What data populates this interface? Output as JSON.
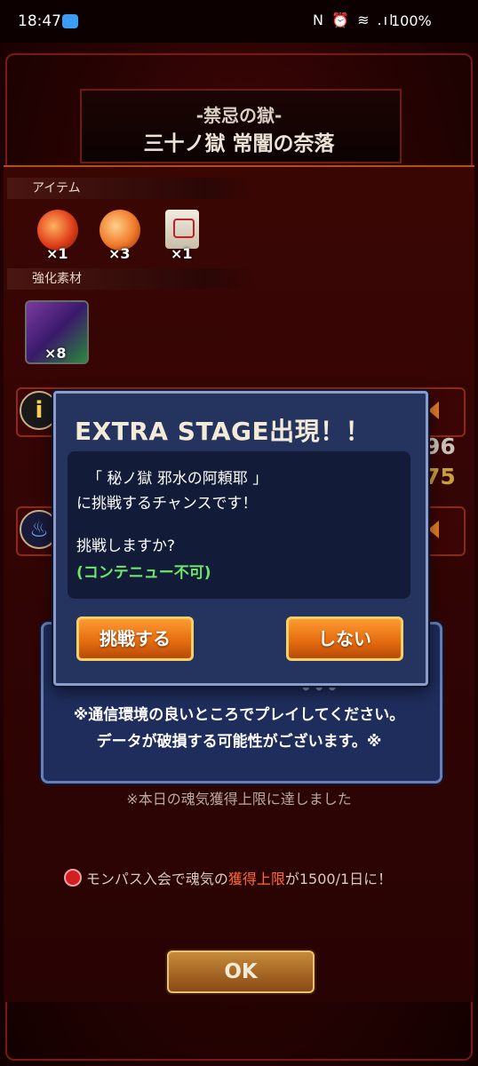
{
  "status_bar": {
    "time": "18:47",
    "right_icons": "N ⏰ ≋ .ıl",
    "battery": "100%"
  },
  "header": {
    "subtitle": "-禁忌の獄-",
    "title": "三十ノ獄 常闇の奈落"
  },
  "rewards": {
    "items_label": "アイテム",
    "items": [
      {
        "icon": "red-orb-icon",
        "count": "×1"
      },
      {
        "icon": "orange-orb-icon",
        "count": "×3"
      },
      {
        "icon": "scroll-icon",
        "count": "×1"
      }
    ],
    "materials_label": "強化素材",
    "materials": [
      {
        "icon": "monster-icon",
        "count": "×8"
      }
    ]
  },
  "background_stats": {
    "value1": "96",
    "value2": "75"
  },
  "notice": {
    "line1": "※通信環境の良いところでプレイしてください。",
    "line2": "データが破損する可能性がございます。※"
  },
  "limit_text": "※本日の魂気獲得上限に達しました",
  "monpass": {
    "prefix": "モンパス入会で魂気の",
    "highlight": "獲得上限",
    "suffix": "が1500/1日に！"
  },
  "ok_label": "OK",
  "modal": {
    "title": "EXTRA STAGE出現！！",
    "line1": "「 秘ノ獄 邪水の阿頼耶 」",
    "line2": "に挑戦するチャンスです！",
    "line3": "挑戦しますか?",
    "line4": "(コンテニュー不可)",
    "yes_label": "挑戦する",
    "no_label": "しない"
  },
  "colors": {
    "modal_bg": "#24345f",
    "button_orange": "#e26a0e",
    "highlight_green": "#6ee66a"
  }
}
